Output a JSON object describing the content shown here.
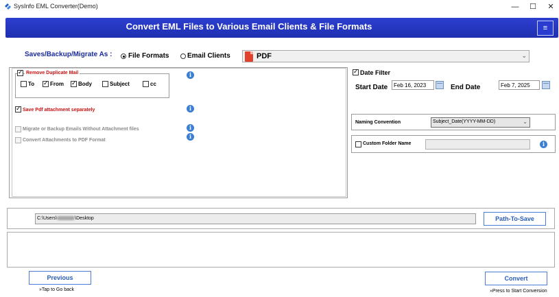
{
  "window": {
    "title": "SysInfo EML Converter(Demo)",
    "controls": {
      "minimize": "—",
      "maximize": "☐",
      "close": "✕"
    }
  },
  "banner": {
    "title": "Convert EML Files to Various Email Clients & File Formats",
    "menu_icon": "≡"
  },
  "save_options": {
    "label": "Saves/Backup/Migrate As :",
    "radio_file_formats": "File Formats",
    "radio_email_clients": "Email Clients",
    "selected_radio": "File Formats",
    "format_value": "PDF"
  },
  "left_options": {
    "remove_duplicate": "Remove Duplicate Mail",
    "fields": [
      "To",
      "From",
      "Body",
      "Subject",
      "cc"
    ],
    "fields_checked": [
      false,
      true,
      true,
      false,
      false
    ],
    "save_pdf_attach": "Save Pdf attachment separately",
    "migrate_without_attach": "Migrate or Backup Emails Without Attachment files",
    "convert_attach_pdf": "Convert Attachments to PDF Format",
    "info_glyph": "i"
  },
  "date_filter": {
    "label": "Date Filter",
    "start_label": "Start Date",
    "start_value": "Feb 16, 2023",
    "end_label": "End Date",
    "end_value": "Feb 7, 2025"
  },
  "naming": {
    "label": "Naming Convention",
    "value": "Subject_Date(YYYY-MM-DD)"
  },
  "custom_folder": {
    "label": "Custom Folder Name",
    "value": ""
  },
  "path": {
    "prefix": "C:\\Users\\",
    "suffix": "\\Desktop",
    "button": "Path-To-Save"
  },
  "footer": {
    "previous": "Previous",
    "previous_hint": "»Tap to Go back",
    "convert": "Convert",
    "convert_hint": "»Press to Start Conversion"
  },
  "colors": {
    "banner": "#2536c4",
    "accent_blue": "#2a5db8",
    "red_label": "#cc1111"
  }
}
